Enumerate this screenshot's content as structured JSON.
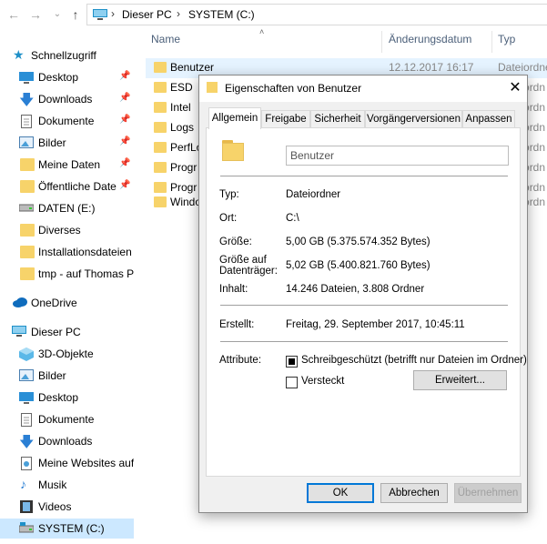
{
  "address": {
    "crumbs": [
      "Dieser PC",
      "SYSTEM (C:)"
    ]
  },
  "columns": {
    "name": "Name",
    "date": "Änderungsdatum",
    "type": "Typ"
  },
  "sidebar": {
    "quick_access": "Schnellzugriff",
    "items": [
      {
        "label": "Desktop",
        "icon": "desktop-icon"
      },
      {
        "label": "Downloads",
        "icon": "download-icon"
      },
      {
        "label": "Dokumente",
        "icon": "documents-icon"
      },
      {
        "label": "Bilder",
        "icon": "pictures-icon"
      },
      {
        "label": "Meine Daten",
        "icon": "folder-icon"
      },
      {
        "label": "Öffentliche Date",
        "icon": "folder-icon"
      },
      {
        "label": "DATEN (E:)",
        "icon": "drive-icon"
      },
      {
        "label": "Diverses",
        "icon": "folder-icon"
      },
      {
        "label": "Installationsdateien",
        "icon": "folder-icon"
      },
      {
        "label": "tmp - auf Thomas P",
        "icon": "folder-icon"
      }
    ],
    "onedrive": "OneDrive",
    "this_pc": "Dieser PC",
    "pc_items": [
      {
        "label": "3D-Objekte",
        "icon": "3d-objects-icon"
      },
      {
        "label": "Bilder",
        "icon": "pictures-icon"
      },
      {
        "label": "Desktop",
        "icon": "desktop-icon"
      },
      {
        "label": "Dokumente",
        "icon": "documents-icon"
      },
      {
        "label": "Downloads",
        "icon": "download-icon"
      },
      {
        "label": "Meine Websites auf",
        "icon": "web-folder-icon"
      },
      {
        "label": "Musik",
        "icon": "music-icon"
      },
      {
        "label": "Videos",
        "icon": "videos-icon"
      },
      {
        "label": "SYSTEM (C:)",
        "icon": "system-drive-icon"
      }
    ]
  },
  "files": [
    {
      "name": "Benutzer",
      "date": "12.12.2017 16:17",
      "type": "Dateiordner"
    },
    {
      "name": "ESD",
      "date": "",
      "type": "Dateiordn"
    },
    {
      "name": "Intel",
      "date": "",
      "type": "Dateiordn"
    },
    {
      "name": "Logs",
      "date": "",
      "type": "Dateiordn"
    },
    {
      "name": "PerfLo",
      "date": "",
      "type": "Dateiordn"
    },
    {
      "name": "Progr",
      "date": "",
      "type": "Dateiordn"
    },
    {
      "name": "Progr",
      "date": "",
      "type": "Dateiordn"
    },
    {
      "name": "Windo",
      "date": "",
      "type": "Dateiordn"
    }
  ],
  "dialog": {
    "title": "Eigenschaften von Benutzer",
    "tabs": [
      "Allgemein",
      "Freigabe",
      "Sicherheit",
      "Vorgängerversionen",
      "Anpassen"
    ],
    "name_value": "Benutzer",
    "props": {
      "type_label": "Typ:",
      "type_value": "Dateiordner",
      "location_label": "Ort:",
      "location_value": "C:\\",
      "size_label": "Größe:",
      "size_value": "5,00 GB (5.375.574.352 Bytes)",
      "disk_size_label_1": "Größe auf",
      "disk_size_label_2": "Datenträger:",
      "disk_size_value": "5,02 GB (5.400.821.760 Bytes)",
      "contents_label": "Inhalt:",
      "contents_value": "14.246 Dateien, 3.808 Ordner",
      "created_label": "Erstellt:",
      "created_value": "Freitag, 29. September 2017, 10:45:11",
      "attributes_label": "Attribute:",
      "readonly_label": "Schreibgeschützt (betrifft nur Dateien im Ordner)",
      "hidden_label": "Versteckt",
      "advanced_button": "Erweitert..."
    },
    "buttons": {
      "ok": "OK",
      "cancel": "Abbrechen",
      "apply": "Übernehmen"
    }
  }
}
